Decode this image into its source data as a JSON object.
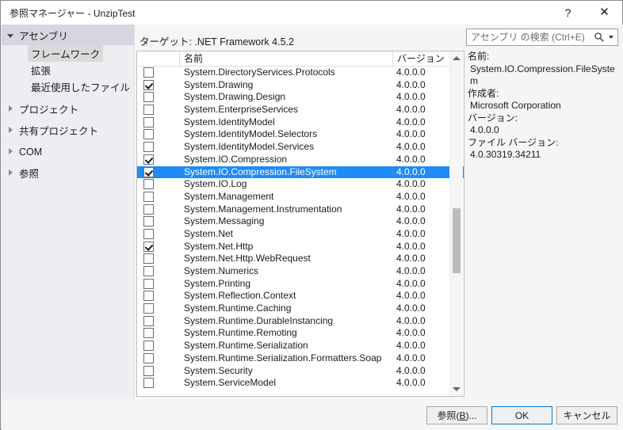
{
  "window": {
    "title": "参照マネージャー - UnzipTest",
    "help_icon": "question-mark-icon",
    "close_icon": "close-icon"
  },
  "sidebar": {
    "groups": [
      {
        "label": "アセンブリ",
        "expanded": true,
        "children": [
          {
            "label": "フレームワーク",
            "selected": true
          },
          {
            "label": "拡張",
            "selected": false
          },
          {
            "label": "最近使用したファイル",
            "selected": false
          }
        ]
      },
      {
        "label": "プロジェクト",
        "expanded": false,
        "children": []
      },
      {
        "label": "共有プロジェクト",
        "expanded": false,
        "children": []
      },
      {
        "label": "COM",
        "expanded": false,
        "children": []
      },
      {
        "label": "参照",
        "expanded": false,
        "children": []
      }
    ]
  },
  "main": {
    "target_label": "ターゲット: .NET Framework 4.5.2",
    "search": {
      "placeholder": "アセンブリ の検索 (Ctrl+E)",
      "value": "",
      "icon": "search-icon",
      "dropdown_icon": "chevron-down-icon"
    },
    "columns": [
      "",
      "名前",
      "バージョン"
    ],
    "rows": [
      {
        "checked": false,
        "name": "System.DirectoryServices.Protocols",
        "version": "4.0.0.0",
        "selected": false
      },
      {
        "checked": true,
        "name": "System.Drawing",
        "version": "4.0.0.0",
        "selected": false
      },
      {
        "checked": false,
        "name": "System.Drawing.Design",
        "version": "4.0.0.0",
        "selected": false
      },
      {
        "checked": false,
        "name": "System.EnterpriseServices",
        "version": "4.0.0.0",
        "selected": false
      },
      {
        "checked": false,
        "name": "System.IdentityModel",
        "version": "4.0.0.0",
        "selected": false
      },
      {
        "checked": false,
        "name": "System.IdentityModel.Selectors",
        "version": "4.0.0.0",
        "selected": false
      },
      {
        "checked": false,
        "name": "System.IdentityModel.Services",
        "version": "4.0.0.0",
        "selected": false
      },
      {
        "checked": true,
        "name": "System.IO.Compression",
        "version": "4.0.0.0",
        "selected": false
      },
      {
        "checked": true,
        "name": "System.IO.Compression.FileSystem",
        "version": "4.0.0.0",
        "selected": true
      },
      {
        "checked": false,
        "name": "System.IO.Log",
        "version": "4.0.0.0",
        "selected": false
      },
      {
        "checked": false,
        "name": "System.Management",
        "version": "4.0.0.0",
        "selected": false
      },
      {
        "checked": false,
        "name": "System.Management.Instrumentation",
        "version": "4.0.0.0",
        "selected": false
      },
      {
        "checked": false,
        "name": "System.Messaging",
        "version": "4.0.0.0",
        "selected": false
      },
      {
        "checked": false,
        "name": "System.Net",
        "version": "4.0.0.0",
        "selected": false
      },
      {
        "checked": true,
        "name": "System.Net.Http",
        "version": "4.0.0.0",
        "selected": false
      },
      {
        "checked": false,
        "name": "System.Net.Http.WebRequest",
        "version": "4.0.0.0",
        "selected": false
      },
      {
        "checked": false,
        "name": "System.Numerics",
        "version": "4.0.0.0",
        "selected": false
      },
      {
        "checked": false,
        "name": "System.Printing",
        "version": "4.0.0.0",
        "selected": false
      },
      {
        "checked": false,
        "name": "System.Reflection.Context",
        "version": "4.0.0.0",
        "selected": false
      },
      {
        "checked": false,
        "name": "System.Runtime.Caching",
        "version": "4.0.0.0",
        "selected": false
      },
      {
        "checked": false,
        "name": "System.Runtime.DurableInstancing",
        "version": "4.0.0.0",
        "selected": false
      },
      {
        "checked": false,
        "name": "System.Runtime.Remoting",
        "version": "4.0.0.0",
        "selected": false
      },
      {
        "checked": false,
        "name": "System.Runtime.Serialization",
        "version": "4.0.0.0",
        "selected": false
      },
      {
        "checked": false,
        "name": "System.Runtime.Serialization.Formatters.Soap",
        "version": "4.0.0.0",
        "selected": false
      },
      {
        "checked": false,
        "name": "System.Security",
        "version": "4.0.0.0",
        "selected": false
      },
      {
        "checked": false,
        "name": "System.ServiceModel",
        "version": "4.0.0.0",
        "selected": false
      }
    ],
    "scrollbar": {
      "up_icon": "triangle-up-icon",
      "down_icon": "triangle-down-icon"
    }
  },
  "details": {
    "name_label": "名前:",
    "name_value": "System.IO.Compression.FileSystem",
    "author_label": "作成者:",
    "author_value": "Microsoft Corporation",
    "version_label": "バージョン:",
    "version_value": "4.0.0.0",
    "file_version_label": "ファイル バージョン:",
    "file_version_value": "4.0.30319.34211"
  },
  "footer": {
    "browse_prefix": "参照(",
    "browse_accel": "B",
    "browse_suffix": ")...",
    "ok_label": "OK",
    "cancel_label": "キャンセル"
  },
  "colors": {
    "selection": "#1f8bf5",
    "focus_border": "#0078d7",
    "sidebar_bg": "#eeeef2",
    "group_header_bg": "#d6d6e0"
  }
}
